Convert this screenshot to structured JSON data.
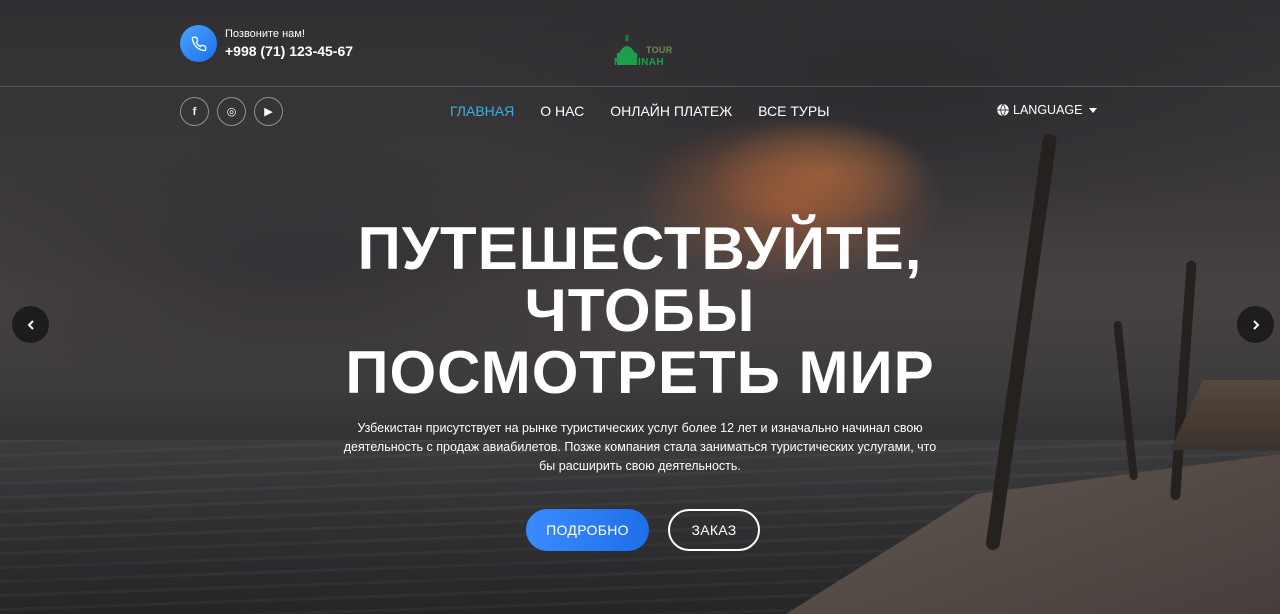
{
  "header": {
    "call_label": "Позвоните нам!",
    "phone": "+998 (71) 123-45-67",
    "logo": {
      "word_top": "TOUR",
      "word_bottom": "MADINAH"
    }
  },
  "socials": [
    {
      "icon": "facebook-icon",
      "glyph": "f"
    },
    {
      "icon": "instagram-icon",
      "glyph": "◎"
    },
    {
      "icon": "youtube-icon",
      "glyph": "▶"
    }
  ],
  "nav": {
    "items": [
      {
        "label": "ГЛАВНАЯ",
        "active": true
      },
      {
        "label": "О НАС",
        "active": false
      },
      {
        "label": "ОНЛАЙН ПЛАТЕЖ",
        "active": false
      },
      {
        "label": "ВСЕ ТУРЫ",
        "active": false
      }
    ],
    "language": "LANGUAGE"
  },
  "hero": {
    "title_lines": [
      "ПУТЕШЕСТВУЙТЕ,",
      "ЧТОБЫ",
      "ПОСМОТРЕТЬ МИР"
    ],
    "description": "Узбекистан присутствует на рынке туристических услуг более 12 лет и изначально начинал свою деятельность с продаж авиабилетов. Позже компания стала заниматься туристических услугами, что бы расширить свою деятельность.",
    "buttons": {
      "more": "ПОДРОБНО",
      "order": "ЗАКАЗ"
    }
  },
  "colors": {
    "accent_blue": "#1e6fe8",
    "nav_active": "#3bb0e6",
    "logo_green": "#16a34a"
  }
}
